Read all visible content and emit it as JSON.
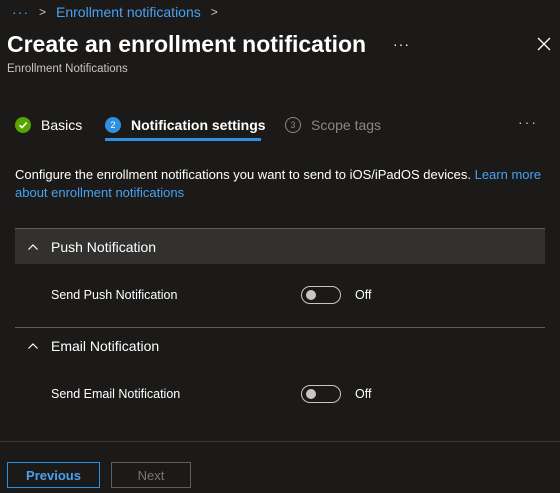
{
  "breadcrumb": {
    "dots": "···",
    "link": "Enrollment notifications",
    "sep1": ">",
    "sep2": ">"
  },
  "header": {
    "title": "Create an enrollment notification",
    "subtitle": "Enrollment Notifications",
    "more": "···"
  },
  "tabs": [
    {
      "label": "Basics",
      "step": "✓"
    },
    {
      "label": "Notification settings",
      "step": "2"
    },
    {
      "label": "Scope tags",
      "step": "3"
    }
  ],
  "tabs_more": "···",
  "description": {
    "text": "Configure the enrollment notifications you want to send to iOS/iPadOS devices. ",
    "link": "Learn more about enrollment notifications"
  },
  "push": {
    "header": "Push Notification",
    "setting_label": "Send Push Notification",
    "toggle_state": "Off"
  },
  "email": {
    "header": "Email Notification",
    "setting_label": "Send Email Notification",
    "toggle_state": "Off"
  },
  "footer": {
    "previous": "Previous",
    "next": "Next"
  },
  "colors": {
    "accent": "#2f8fe0",
    "link": "#4aa0f0",
    "success": "#57a300",
    "background": "#1b1a19"
  }
}
